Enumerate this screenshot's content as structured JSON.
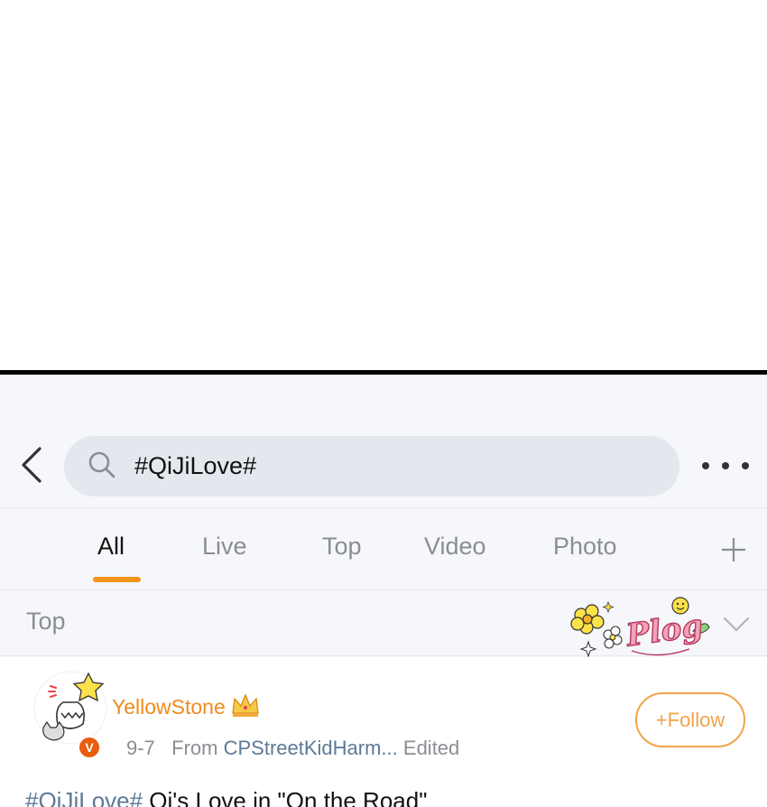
{
  "search": {
    "query": "#QiJiLove#"
  },
  "tabs": [
    {
      "label": "All",
      "active": true
    },
    {
      "label": "Live",
      "active": false
    },
    {
      "label": "Top",
      "active": false
    },
    {
      "label": "Video",
      "active": false
    },
    {
      "label": "Photo",
      "active": false
    }
  ],
  "section": {
    "label": "Top",
    "sticker_text": "Plog"
  },
  "post": {
    "username": "YellowStone",
    "date": "9-7",
    "from_label": "From",
    "source": "CPStreetKidHarm...",
    "edited_label": "Edited",
    "follow_label": "+Follow",
    "badge_letter": "V",
    "hashtag": "#QiJiLove#",
    "text": " Qi's Love in \"On the Road\""
  },
  "colors": {
    "accent": "#f1961b",
    "username": "#f08a1d",
    "link": "#5c7a96",
    "search_bg": "#e4e7ed"
  },
  "icons": [
    "back-chevron-icon",
    "search-icon",
    "more-dots-icon",
    "plus-icon",
    "chevron-down-icon",
    "crown-icon",
    "verified-icon"
  ]
}
